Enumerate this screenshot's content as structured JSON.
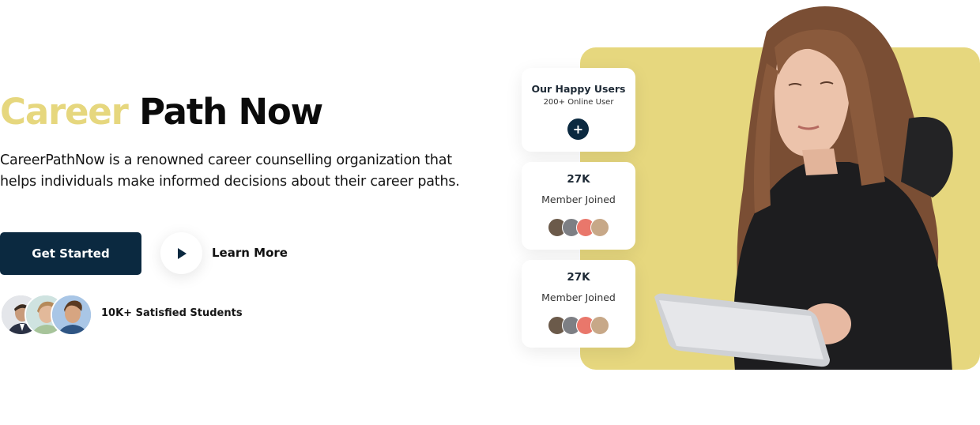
{
  "hero": {
    "title_accent": "Career",
    "title_rest": "Path Now",
    "description": "CareerPathNow is a renowned career counselling organization that helps individuals make informed decisions about their career paths.",
    "get_started_label": "Get Started",
    "learn_more_label": "Learn More",
    "students_label": "10K+ Satisfied Students"
  },
  "cards": {
    "happy_users": {
      "title": "Our Happy Users",
      "subtitle": "200+ Online User",
      "button_glyph": "+"
    },
    "members_1": {
      "value": "27K",
      "label": "Member Joined"
    },
    "members_2": {
      "value": "27K",
      "label": "Member Joined"
    }
  },
  "icons": {
    "play": "play-icon",
    "plus": "plus-icon"
  },
  "colors": {
    "accent_yellow": "#e6d77e",
    "navy": "#0b2940",
    "text_dark": "#0b0b0b",
    "panel_yellow": "#e6d77e"
  }
}
